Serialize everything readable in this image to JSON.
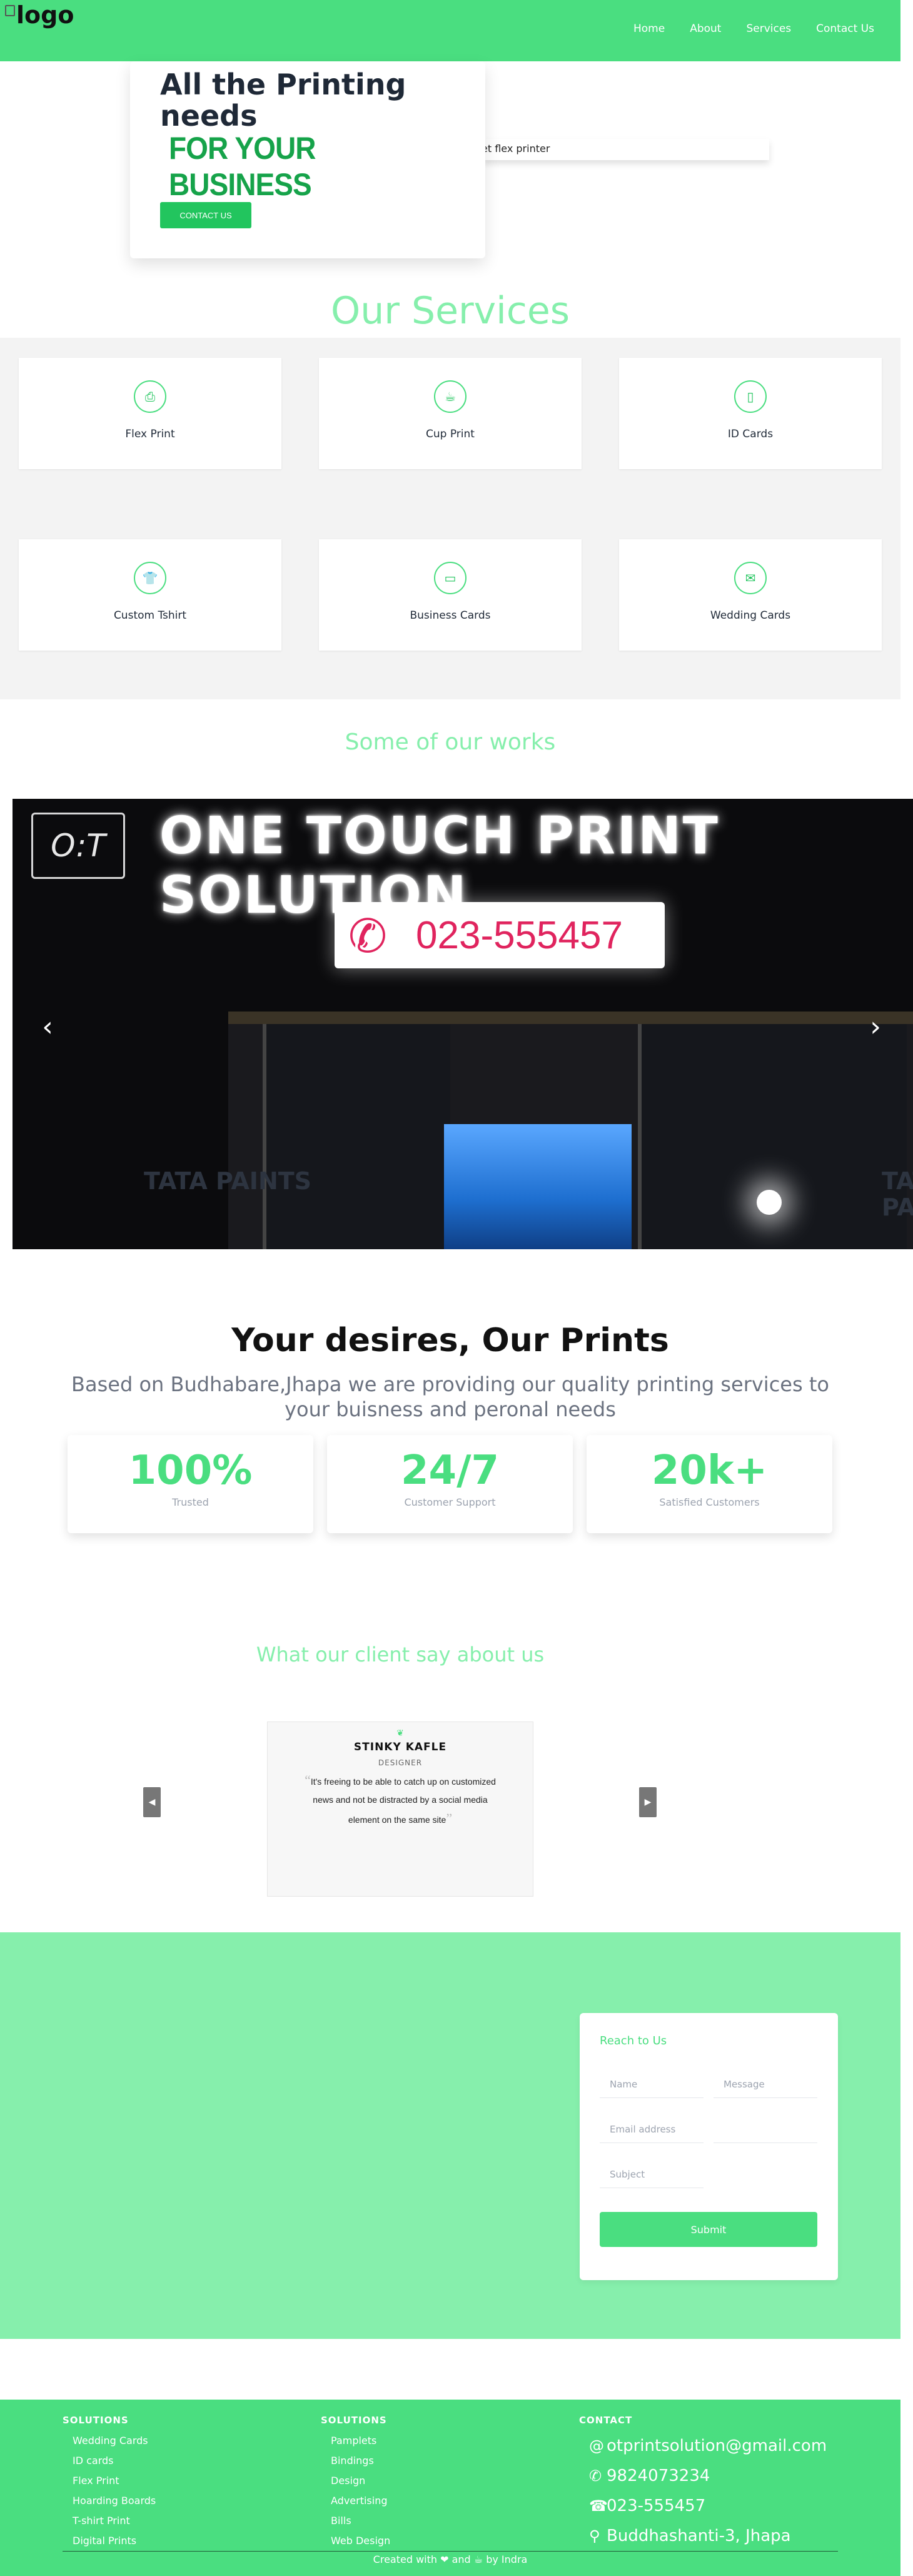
{
  "nav": {
    "logo_alt": "logo",
    "links": [
      "Home",
      "About",
      "Services",
      "Contact Us"
    ]
  },
  "hero": {
    "title": "All the Printing needs",
    "accent": "FOR YOUR BUSINESS",
    "cta": "CONTACT US",
    "subtext": "et flex printer"
  },
  "services": {
    "title": "Our Services",
    "items": [
      {
        "label": "Flex Print",
        "icon": "printer-icon"
      },
      {
        "label": "Cup Print",
        "icon": "cup-icon"
      },
      {
        "label": "ID Cards",
        "icon": "id-badge-icon"
      },
      {
        "label": "Custom Tshirt",
        "icon": "tshirt-icon"
      },
      {
        "label": "Business Cards",
        "icon": "business-card-icon"
      },
      {
        "label": "Wedding Cards",
        "icon": "envelope-icon"
      }
    ]
  },
  "works": {
    "title": "Some of our works",
    "slide": {
      "sign_text": "ONE TOUCH PRINT SOLUTION",
      "phone": "023-555457",
      "side_text": "TATA PAINTS"
    }
  },
  "desires": {
    "title": "Your desires, Our Prints",
    "subtitle": "Based on Budhabare,Jhapa we are providing our quality printing services to your buisness and peronal needs",
    "stats": [
      {
        "value": "100%",
        "caption": "Trusted"
      },
      {
        "value": "24/7",
        "caption": "Customer Support"
      },
      {
        "value": "20k+",
        "caption": "Satisfied Customers"
      }
    ]
  },
  "testimonial": {
    "title": "What our client say about us",
    "name": "STINKY KAFLE",
    "role": "DESIGNER",
    "quote": "It's freeing to be able to catch up on customized news and not be distracted by a social media element on the same site",
    "prev": "◀",
    "next": "▶"
  },
  "contact": {
    "heading": "Reach to Us",
    "name_placeholder": "Name",
    "message_placeholder": "Message",
    "email_placeholder": "Email address",
    "subject_placeholder": "Subject",
    "submit": "Submit"
  },
  "footer": {
    "solutions_heading_1": "SOLUTIONS",
    "solutions_1": [
      "Wedding Cards",
      "ID cards",
      "Flex Print",
      "Hoarding Boards",
      "T-shirt Print",
      "Digital Prints"
    ],
    "solutions_heading_2": "SOLUTIONS",
    "solutions_2": [
      "Pamplets",
      "Bindings",
      "Design",
      "Advertising",
      "Bills",
      "Web Design"
    ],
    "contact_heading": "CONTACT",
    "email": "otprintsolution@gmail.com",
    "whatsapp": "9824073234",
    "phone": "023-555457",
    "address": "Buddhashanti-3, Jhapa",
    "credit": "Created with ❤ and ☕ by Indra"
  },
  "colors": {
    "brand": "#4ade80",
    "brand_light": "#86efac",
    "brand_dark": "#22c55e"
  }
}
